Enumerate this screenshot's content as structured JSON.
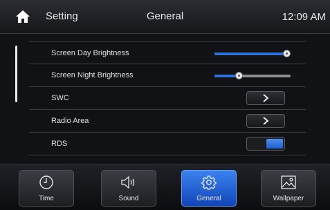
{
  "header": {
    "setting_label": "Setting",
    "title": "General",
    "time": "12:09 AM"
  },
  "settings": {
    "day_brightness": {
      "label": "Screen Day Brightness",
      "value": 1.0
    },
    "night_brightness": {
      "label": "Screen Night Brightness",
      "value": 0.3
    },
    "swc": {
      "label": "SWC"
    },
    "radio_area": {
      "label": "Radio Area"
    },
    "rds": {
      "label": "RDS",
      "enabled": true
    }
  },
  "tabs": [
    {
      "label": "Time",
      "icon": "clock-icon",
      "active": false
    },
    {
      "label": "Sound",
      "icon": "speaker-icon",
      "active": false
    },
    {
      "label": "General",
      "icon": "gear-icon",
      "active": true
    },
    {
      "label": "Wallpaper",
      "icon": "image-icon",
      "active": false
    }
  ],
  "colors": {
    "accent": "#2f6fd6",
    "active_tab": "#2a6be0",
    "background": "#101216"
  }
}
